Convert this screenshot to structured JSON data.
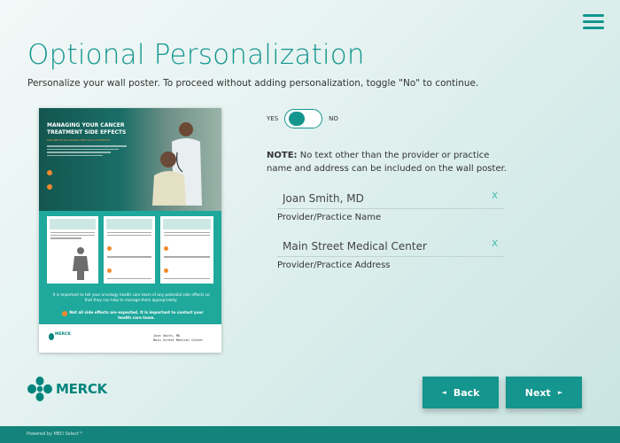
{
  "page": {
    "title": "Optional Personalization",
    "subtitle": "Personalize your wall poster. To proceed without adding personalization, toggle \"No\" to continue."
  },
  "menu": {
    "icon": "hamburger-menu-icon"
  },
  "poster": {
    "hero_title": "MANAGING YOUR CANCER TREATMENT SIDE EFFECTS",
    "hero_subtitle": "Side effects are possible with cancer treatment",
    "card_titles": [
      "Side Effects Of Cancer Treatment",
      "Get Help Especially During Cancer Treatment",
      "Notifying Side Effects You Are Not Bored To"
    ],
    "band_text": "It is important to tell your oncology health care team of any potential side effects so that they can help to manage them appropriately.",
    "band_strong": "Not all side effects are expected. It is important to contact your health care team.",
    "footer_brand": "MERCK",
    "footer_name": "Joan Smith, MD",
    "footer_practice": "Main Street Medical Center"
  },
  "toggle": {
    "yes_label": "YES",
    "no_label": "NO",
    "state": "YES"
  },
  "note": {
    "label": "NOTE:",
    "text": " No text other than the provider or practice name and address can be included on the wall poster."
  },
  "fields": {
    "name": {
      "value": "Joan Smith, MD",
      "label": "Provider/Practice Name",
      "clear": "X"
    },
    "address": {
      "value": "Main Street Medical Center",
      "label": "Provider/Practice Address",
      "clear": "X"
    }
  },
  "logo": {
    "word": "MERCK"
  },
  "buttons": {
    "back": "Back",
    "next": "Next",
    "back_arrow": "◄",
    "next_arrow": "►"
  },
  "footer": {
    "text": "Powered by MED Select™"
  },
  "colors": {
    "accent": "#14958e",
    "orange": "#f08a2c",
    "footer": "#13847b"
  }
}
